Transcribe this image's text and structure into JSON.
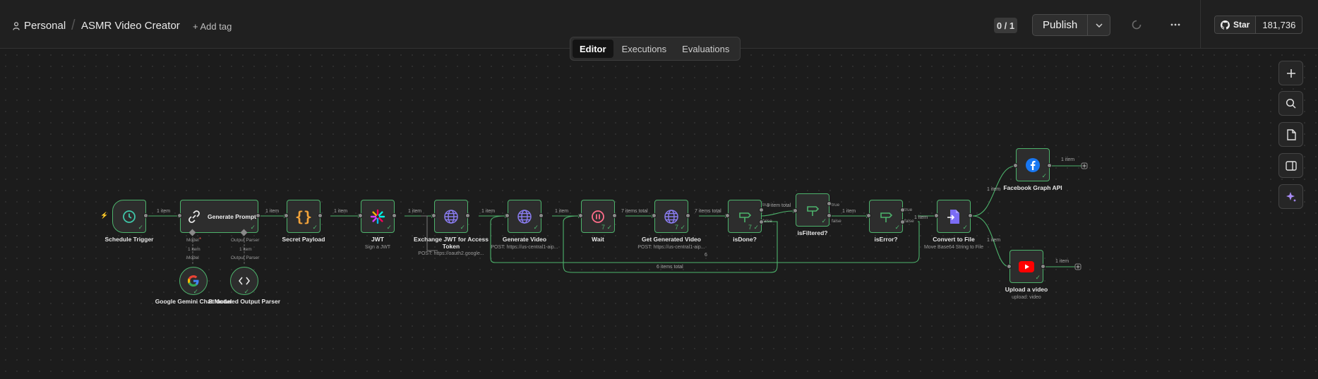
{
  "header": {
    "workspace": "Personal",
    "workflow_name": "ASMR Video Creator",
    "add_tag": "+ Add tag",
    "counter": "0 / 1",
    "publish_label": "Publish",
    "github_star_label": "Star",
    "github_star_count": "181,736"
  },
  "tabs": [
    {
      "label": "Editor",
      "active": true
    },
    {
      "label": "Executions",
      "active": false
    },
    {
      "label": "Evaluations",
      "active": false
    }
  ],
  "nodes": {
    "schedule_trigger": {
      "label": "Schedule Trigger"
    },
    "generate_prompt": {
      "label": "Generate Prompt",
      "model_port": "Model",
      "parser_port": "Output Parser"
    },
    "gemini": {
      "label": "Google Gemini Chat Model"
    },
    "parser": {
      "label": "Structured Output Parser"
    },
    "secret_payload": {
      "label": "Secret Payload"
    },
    "jwt": {
      "label": "JWT",
      "sub": "Sign a JWT"
    },
    "exchange_jwt": {
      "label": "Exchange JWT for Access Token",
      "sub": "POST: https://oauth2.google..."
    },
    "generate_video": {
      "label": "Generate Video",
      "sub": "POST: https://us-central1-aip..."
    },
    "wait": {
      "label": "Wait"
    },
    "get_generated_video": {
      "label": "Get Generated Video",
      "sub": "POST: https://us-central1-aip..."
    },
    "is_done": {
      "label": "isDone?"
    },
    "is_filtered": {
      "label": "isFiltered?"
    },
    "is_error": {
      "label": "isError?"
    },
    "convert_to_file": {
      "label": "Convert to File",
      "sub": "Move Base64 String to File"
    },
    "facebook": {
      "label": "Facebook Graph API"
    },
    "upload_video": {
      "label": "Upload a video",
      "sub": "upload: video"
    }
  },
  "edges": {
    "one_item": "1 item",
    "seven_items_total": "7 items total",
    "one_item_total": "1 item total",
    "six_items_total": "6 items total",
    "true": "true",
    "false": "false",
    "six": "6",
    "seven": "7"
  },
  "colors": {
    "accent_green": "#4db36c",
    "publish_bg": "#2f2f2f",
    "canvas_bg": "#1c1c1c"
  }
}
